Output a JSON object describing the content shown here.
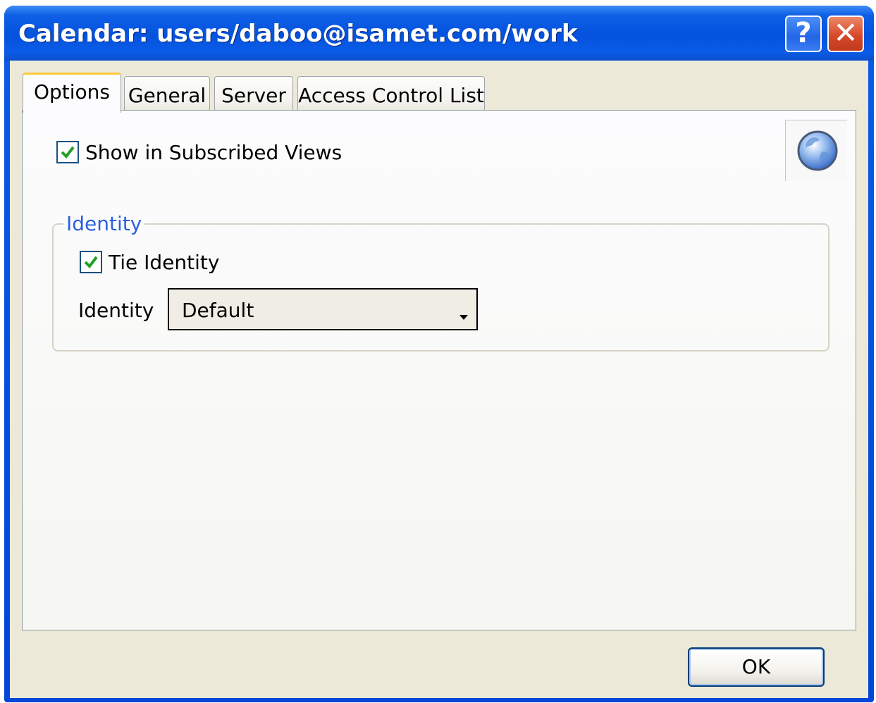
{
  "window": {
    "title": "Calendar: users/daboo@isamet.com/work",
    "help_glyph": "?",
    "close_glyph": "✕"
  },
  "tabs": [
    {
      "label": "Options",
      "active": true
    },
    {
      "label": "General",
      "active": false
    },
    {
      "label": "Server",
      "active": false
    },
    {
      "label": "Access Control List",
      "active": false
    }
  ],
  "options": {
    "show_subscribed_label": "Show in Subscribed Views",
    "show_subscribed_checked": true,
    "globe_icon": "globe-icon"
  },
  "identity_group": {
    "title": "Identity",
    "tie_identity_label": "Tie Identity",
    "tie_identity_checked": true,
    "identity_label": "Identity",
    "identity_value": "Default"
  },
  "buttons": {
    "ok_label": "OK"
  },
  "colors": {
    "titlebar": "#0452dd",
    "group_title": "#2b5fe0",
    "checkmark": "#21a121",
    "active_tab_accent": "#ffc83c"
  }
}
